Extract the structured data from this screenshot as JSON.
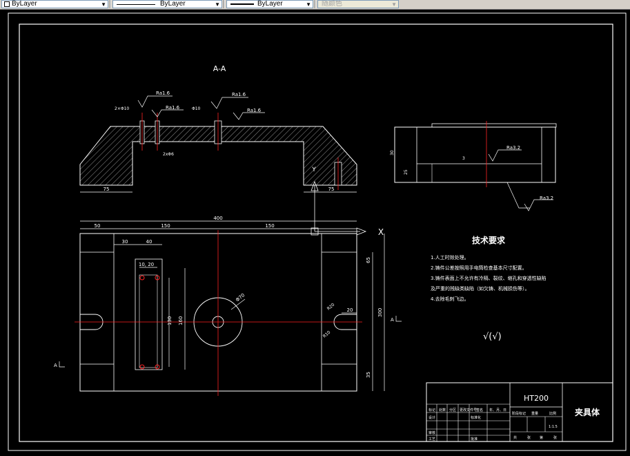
{
  "toolbar": {
    "layer_combo": {
      "value": "ByLayer"
    },
    "linetype_combo": {
      "value": "ByLayer"
    },
    "lineweight_combo": {
      "value": "ByLayer"
    },
    "plotstyle_combo": {
      "value": "随颜色"
    }
  },
  "drawing": {
    "section_title": "A-A",
    "section_dims": [
      "75",
      "75"
    ],
    "roughness": [
      "Ra1.6",
      "Ra1.6",
      "Ra1.6",
      "Ra1.6"
    ],
    "tolerances": [
      "2×Φ10",
      "Φ10",
      "2xΦ6"
    ],
    "plan_dims": {
      "overall": "400",
      "d50": "50",
      "d150a": "150",
      "d150b": "150",
      "d30": "30",
      "d40": "40",
      "d10_20": "10, 20",
      "d30b": "30",
      "d20": "20",
      "d65": "65",
      "d35": "35",
      "d300": "300",
      "d130": "130",
      "d160": "160",
      "phi70": "Φ70",
      "r20": "R20",
      "r10": "R10"
    },
    "side_dims": {
      "d30": "30",
      "d25": "25",
      "d3": "3",
      "ra3_2a": "Ra3.2",
      "ra3_2b": "Ra3.2"
    },
    "x_axis": "X",
    "y_axis": "Y",
    "a_marker": "A",
    "tech_title": "技术要求",
    "tech_req": [
      "1.人工时效处理。",
      "2.铸件公差按照用手电筒检查基本尺寸配置。",
      "3.铸件表面上不允许有冷隔、裂纹、缩孔和穿透性缺陷",
      "及严重的残缺类缺陷（如欠铸、机械损伤等）。",
      "4.去除毛刺飞边。"
    ],
    "general_roughness": "√(√)",
    "title_block": {
      "material": "HT200",
      "part_name": "夹具体",
      "scale": "1:1.5",
      "head_labels": [
        "标记",
        "处数",
        "分区",
        "更改文件号",
        "签名",
        "年、月、日"
      ],
      "row_labels": [
        "设计",
        "标准化",
        "审核",
        "工艺",
        "批准"
      ],
      "stage_labels": [
        "阶段标记",
        "重量",
        "比例"
      ],
      "sheet_labels": [
        "共",
        "张",
        "第",
        "张"
      ]
    }
  }
}
